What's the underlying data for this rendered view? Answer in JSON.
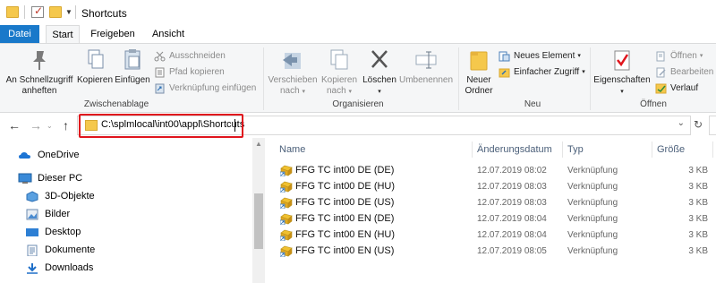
{
  "window": {
    "title": "Shortcuts"
  },
  "tabs": [
    "Datei",
    "Start",
    "Freigeben",
    "Ansicht"
  ],
  "ribbon": {
    "clipboard": {
      "label": "Zwischenablage",
      "pin": "An Schnellzugriff anheften",
      "copy": "Kopieren",
      "paste": "Einfügen",
      "cut": "Ausschneiden",
      "copy_path": "Pfad kopieren",
      "paste_shortcut": "Verknüpfung einfügen"
    },
    "organize": {
      "label": "Organisieren",
      "move_to": "Verschieben nach",
      "copy_to": "Kopieren nach",
      "delete": "Löschen",
      "rename": "Umbenennen"
    },
    "new": {
      "label": "Neu",
      "new_folder": "Neuer Ordner",
      "new_item": "Neues Element",
      "easy_access": "Einfacher Zugriff"
    },
    "open": {
      "label": "Öffnen",
      "properties": "Eigenschaften",
      "open": "Öffnen",
      "edit": "Bearbeiten",
      "history": "Verlauf"
    }
  },
  "address": {
    "path": "C:\\splmlocal\\int00\\appl\\Shortcuts"
  },
  "nav": {
    "items": [
      {
        "label": "OneDrive",
        "icon": "onedrive-icon"
      },
      {
        "label": "Dieser PC",
        "icon": "pc-icon"
      },
      {
        "label": "3D-Objekte",
        "icon": "3d-objects-icon"
      },
      {
        "label": "Bilder",
        "icon": "pictures-icon"
      },
      {
        "label": "Desktop",
        "icon": "desktop-icon"
      },
      {
        "label": "Dokumente",
        "icon": "documents-icon"
      },
      {
        "label": "Downloads",
        "icon": "downloads-icon"
      }
    ]
  },
  "files": {
    "columns": [
      "Name",
      "Änderungsdatum",
      "Typ",
      "Größe"
    ],
    "rows": [
      {
        "name": "FFG TC int00 DE (DE)",
        "date": "12.07.2019 08:02",
        "type": "Verknüpfung",
        "size": "3 KB"
      },
      {
        "name": "FFG TC int00 DE (HU)",
        "date": "12.07.2019 08:03",
        "type": "Verknüpfung",
        "size": "3 KB"
      },
      {
        "name": "FFG TC int00 DE (US)",
        "date": "12.07.2019 08:03",
        "type": "Verknüpfung",
        "size": "3 KB"
      },
      {
        "name": "FFG TC int00 EN (DE)",
        "date": "12.07.2019 08:04",
        "type": "Verknüpfung",
        "size": "3 KB"
      },
      {
        "name": "FFG TC int00 EN (HU)",
        "date": "12.07.2019 08:04",
        "type": "Verknüpfung",
        "size": "3 KB"
      },
      {
        "name": "FFG TC int00 EN (US)",
        "date": "12.07.2019 08:05",
        "type": "Verknüpfung",
        "size": "3 KB"
      }
    ]
  },
  "colors": {
    "accent": "#1979ca",
    "highlight": "#e0151d",
    "folder": "#f5c84c"
  }
}
